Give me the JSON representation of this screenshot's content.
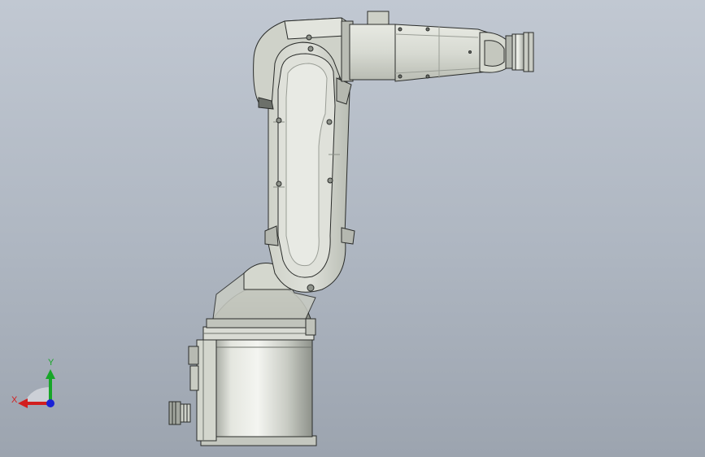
{
  "triad": {
    "x_label": "X",
    "y_label": "Y",
    "x_color": "#d21f1f",
    "y_color": "#17a628",
    "z_color": "#1a22d6"
  },
  "colors": {
    "background_top": "#c1c8d2",
    "background_bottom": "#9ca4af",
    "part_light": "#dcdfd6",
    "part_mid": "#c6c9bf",
    "part_dark": "#8f938b",
    "edge": "#2a2c2a"
  }
}
